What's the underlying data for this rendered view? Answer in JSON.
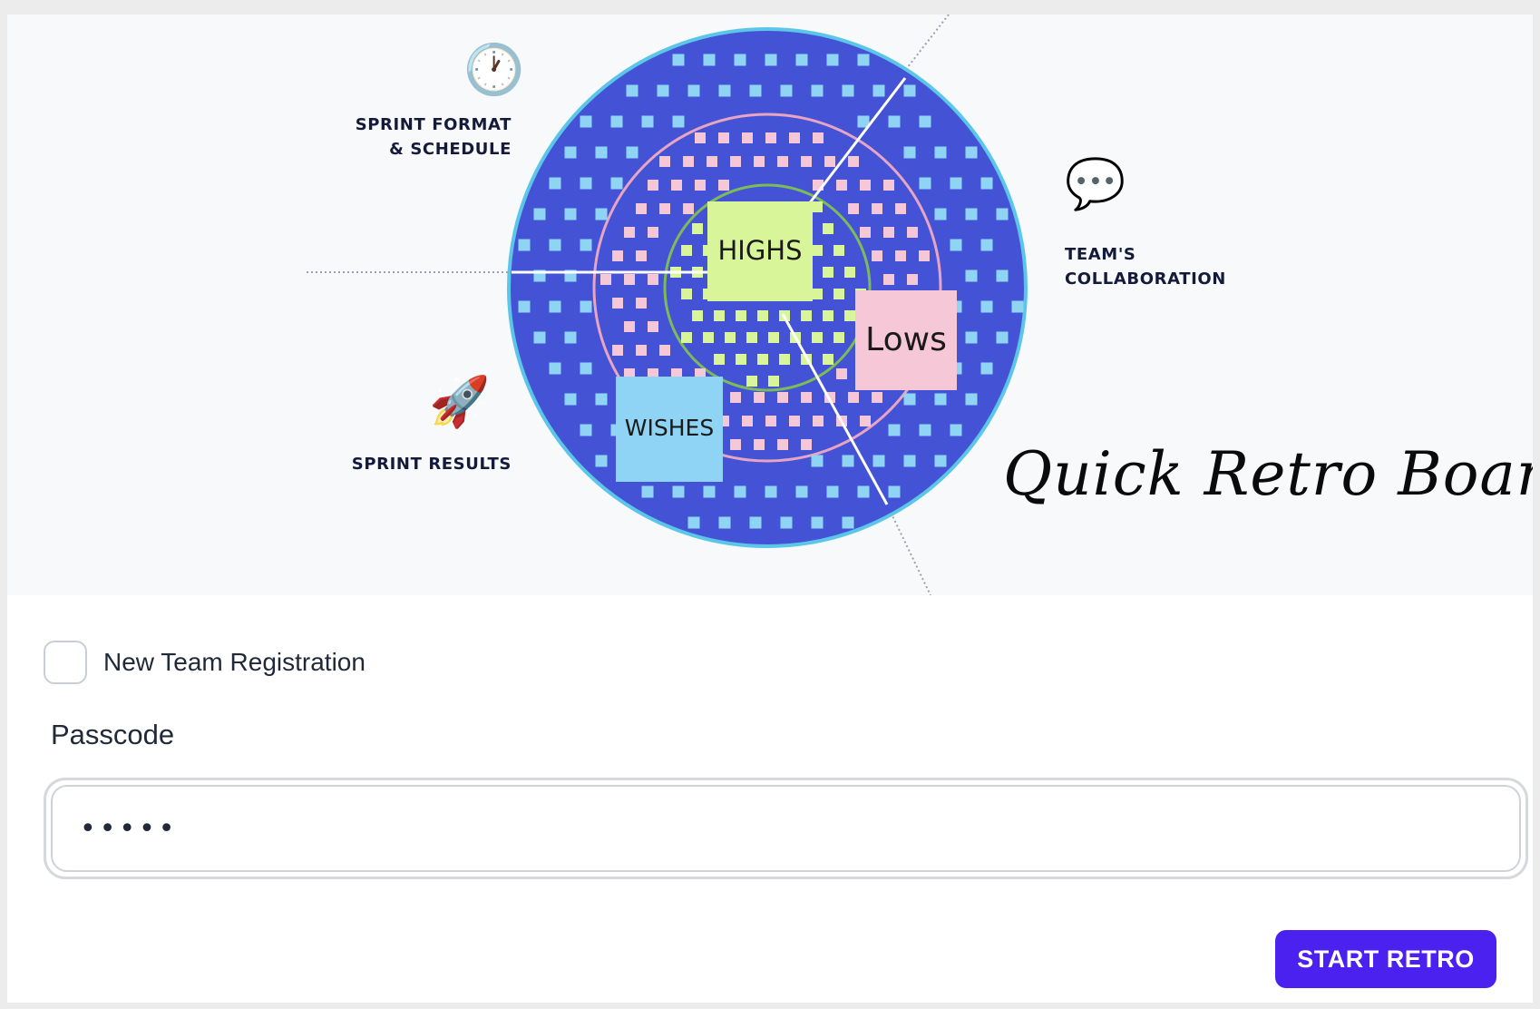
{
  "hero": {
    "labels": {
      "sprint_format_line1": "SPRINT FORMAT",
      "sprint_format_line2": "& SCHEDULE",
      "collab_line1": "TEAM'S",
      "collab_line2": "COLLABORATION",
      "results": "SPRINT RESULTS"
    },
    "stickies": {
      "highs": "HIGHS",
      "lows": "Lows",
      "wishes": "WISHES"
    },
    "title": "Quick Retro Board",
    "icons": {
      "clock": "clock-icon",
      "speech": "speech-bubble-icon",
      "rocket": "rocket-icon"
    },
    "colors": {
      "outer_ring": "#4453d6",
      "outer_border": "#5bc6e8",
      "middle_ring": "#e8a5c2",
      "inner_ring": "#7dbb5a",
      "highs_note": "#d9f59a",
      "lows_note": "#f6c7d7",
      "wishes_note": "#8fd4f4",
      "blue_tile": "#8fd4f4",
      "pink_tile": "#f6c7d7",
      "green_tile": "#d9f59a"
    }
  },
  "form": {
    "new_team_label": "New Team Registration",
    "passcode_label": "Passcode",
    "passcode_value": "12345",
    "start_button_label": "START RETRO",
    "accent_color": "#4a21ee"
  }
}
